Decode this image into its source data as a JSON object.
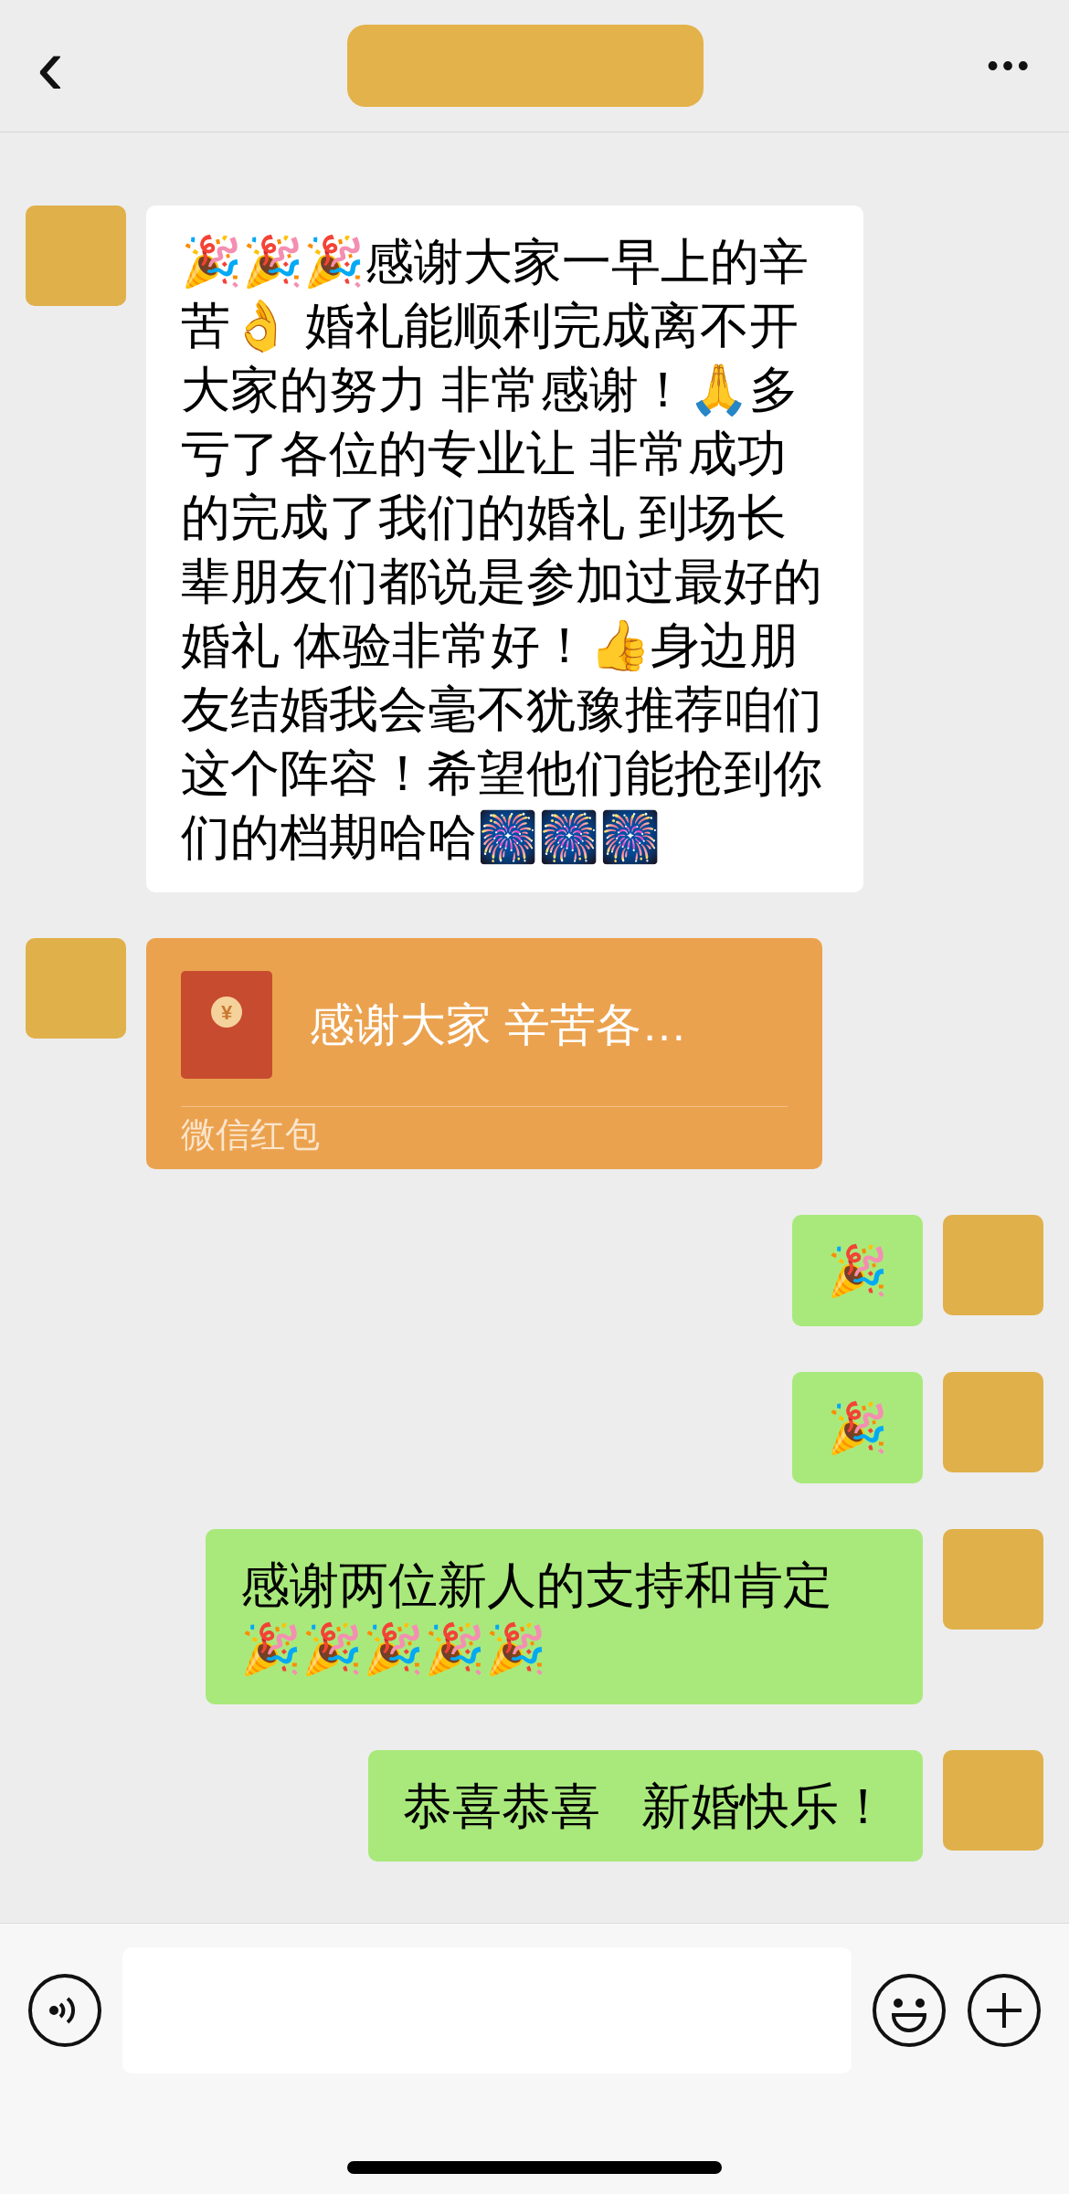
{
  "header": {
    "back": "‹",
    "more": "•••"
  },
  "messages": [
    {
      "kind": "text",
      "outgoing": false,
      "text": "🎉🎉🎉感谢大家一早上的辛苦👌 婚礼能顺利完成离不开大家的努力 非常感谢！🙏多亏了各位的专业让 非常成功的完成了我们的婚礼 到场长辈朋友们都说是参加过最好的婚礼 体验非常好！👍身边朋友结婚我会毫不犹豫推荐咱们这个阵容！希望他们能抢到你们的档期哈哈🎆🎆🎆"
    },
    {
      "kind": "red_packet",
      "outgoing": false,
      "coin": "¥",
      "text": "感谢大家 辛苦各…",
      "footer": "微信红包"
    },
    {
      "kind": "text",
      "outgoing": true,
      "text": "🎉"
    },
    {
      "kind": "text",
      "outgoing": true,
      "text": "🎉"
    },
    {
      "kind": "text",
      "outgoing": true,
      "text": "感谢两位新人的支持和肯定🎉🎉🎉🎉🎉"
    },
    {
      "kind": "text",
      "outgoing": true,
      "text": "恭喜恭喜   新婚快乐！"
    }
  ]
}
